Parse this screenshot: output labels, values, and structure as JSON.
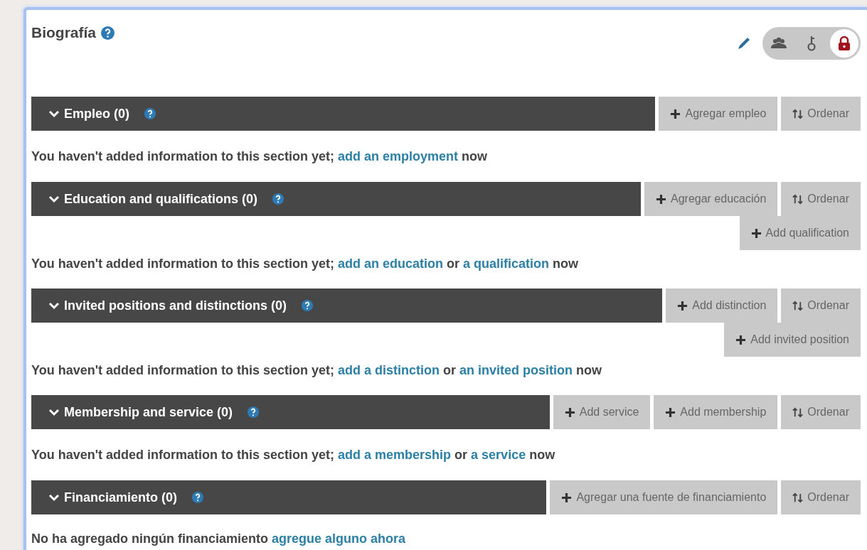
{
  "panel": {
    "title": "Biografía",
    "visibility": [
      {
        "kind": "everyone",
        "selected": false
      },
      {
        "kind": "trusted",
        "selected": false
      },
      {
        "kind": "private",
        "selected": true
      }
    ]
  },
  "sections": [
    {
      "title": "Empleo (0)",
      "expanded": true,
      "buttons": [
        {
          "kind": "add",
          "label": "Agregar empleo"
        },
        {
          "kind": "sort",
          "label": "Ordenar"
        }
      ],
      "message": [
        {
          "kind": "text",
          "text": "You haven't added information to this section yet;"
        },
        {
          "kind": "link",
          "text": "add an employment"
        },
        {
          "kind": "text",
          "text": "now"
        }
      ]
    },
    {
      "title": "Education and qualifications (0)",
      "expanded": true,
      "buttons": [
        {
          "kind": "add",
          "label": "Agregar educación"
        },
        {
          "kind": "sort",
          "label": "Ordenar"
        }
      ],
      "extra_buttons": [
        {
          "kind": "add",
          "label": "Add qualification"
        }
      ],
      "message": [
        {
          "kind": "text",
          "text": "You haven't added information to this section yet;"
        },
        {
          "kind": "link",
          "text": "add an education"
        },
        {
          "kind": "text",
          "text": "or"
        },
        {
          "kind": "link",
          "text": "a qualification"
        },
        {
          "kind": "text",
          "text": "now"
        }
      ]
    },
    {
      "title": "Invited positions and distinctions (0)",
      "expanded": true,
      "buttons": [
        {
          "kind": "add",
          "label": "Add distinction"
        },
        {
          "kind": "sort",
          "label": "Ordenar"
        }
      ],
      "extra_buttons": [
        {
          "kind": "add",
          "label": "Add invited position"
        }
      ],
      "message": [
        {
          "kind": "text",
          "text": "You haven't added information to this section yet;"
        },
        {
          "kind": "link",
          "text": "add a distinction"
        },
        {
          "kind": "text",
          "text": "or"
        },
        {
          "kind": "link",
          "text": "an invited position"
        },
        {
          "kind": "text",
          "text": "now"
        }
      ]
    },
    {
      "title": "Membership and service (0)",
      "expanded": true,
      "buttons": [
        {
          "kind": "add",
          "label": "Add service"
        },
        {
          "kind": "add",
          "label": "Add membership"
        },
        {
          "kind": "sort",
          "label": "Ordenar"
        }
      ],
      "message": [
        {
          "kind": "text",
          "text": "You haven't added information to this section yet;"
        },
        {
          "kind": "link",
          "text": "add a membership"
        },
        {
          "kind": "text",
          "text": "or"
        },
        {
          "kind": "link",
          "text": "a service"
        },
        {
          "kind": "text",
          "text": "now"
        }
      ]
    },
    {
      "title": "Financiamiento (0)",
      "expanded": true,
      "buttons": [
        {
          "kind": "add",
          "label": "Agregar una fuente de financiamiento"
        },
        {
          "kind": "sort",
          "label": "Ordenar"
        }
      ],
      "message": [
        {
          "kind": "text",
          "text": "No ha agregado ningún financiamiento"
        },
        {
          "kind": "link",
          "text": "agregue alguno ahora"
        }
      ]
    }
  ]
}
